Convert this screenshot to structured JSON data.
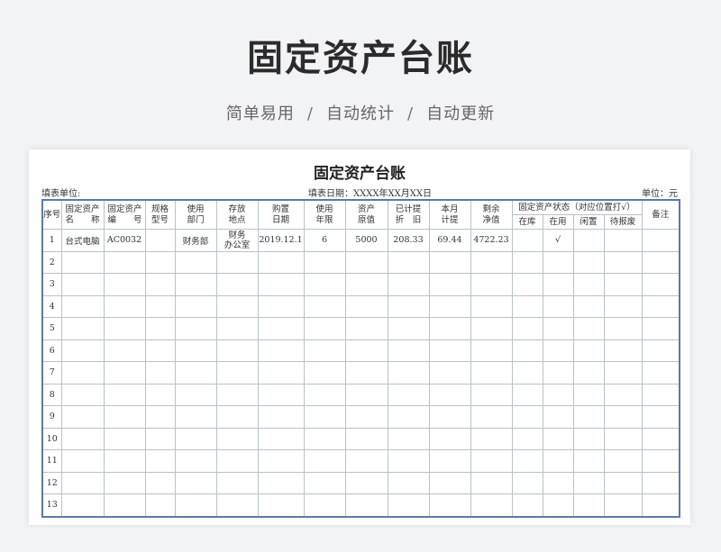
{
  "hero": {
    "title": "固定资产台账",
    "features": [
      "简单易用",
      "自动统计",
      "自动更新"
    ],
    "separator": "/"
  },
  "sheet": {
    "title": "固定资产台账",
    "unit_label": "填表单位:",
    "date_label": "填表日期：XXXX年XX月XX日",
    "currency_label": "单位：元",
    "headers": {
      "seq": "序号",
      "name": [
        "固定资产",
        "名　　称"
      ],
      "code": [
        "固定资产",
        "编　　号"
      ],
      "spec": [
        "规格",
        "型号"
      ],
      "dept": [
        "使用",
        "部门"
      ],
      "location": [
        "存放",
        "地点"
      ],
      "purchase_date": [
        "购置",
        "日期"
      ],
      "life": [
        "使用",
        "年限"
      ],
      "value": [
        "资产",
        "原值"
      ],
      "accumulated": [
        "已计提",
        "折　旧"
      ],
      "monthly": [
        "本月",
        "计提"
      ],
      "net": [
        "剩余",
        "净值"
      ],
      "status_group": "固定资产状态（对应位置打√）",
      "status": [
        "在库",
        "在用",
        "闲置",
        "待报废"
      ],
      "remark": "备注"
    },
    "rows": [
      {
        "seq": "1",
        "name": "台式电脑",
        "code": "AC0032",
        "spec": "",
        "dept": "财务部",
        "location": [
          "财务",
          "办公室"
        ],
        "date": "2019.12.1",
        "life": "6",
        "value": "5000",
        "accumulated": "208.33",
        "monthly": "69.44",
        "net": "4722.23",
        "s0": "",
        "s1": "√",
        "s2": "",
        "s3": "",
        "remark": ""
      },
      {
        "seq": "2"
      },
      {
        "seq": "3"
      },
      {
        "seq": "4"
      },
      {
        "seq": "5"
      },
      {
        "seq": "6"
      },
      {
        "seq": "7"
      },
      {
        "seq": "8"
      },
      {
        "seq": "9"
      },
      {
        "seq": "10"
      },
      {
        "seq": "11"
      },
      {
        "seq": "12"
      },
      {
        "seq": "13"
      }
    ]
  }
}
